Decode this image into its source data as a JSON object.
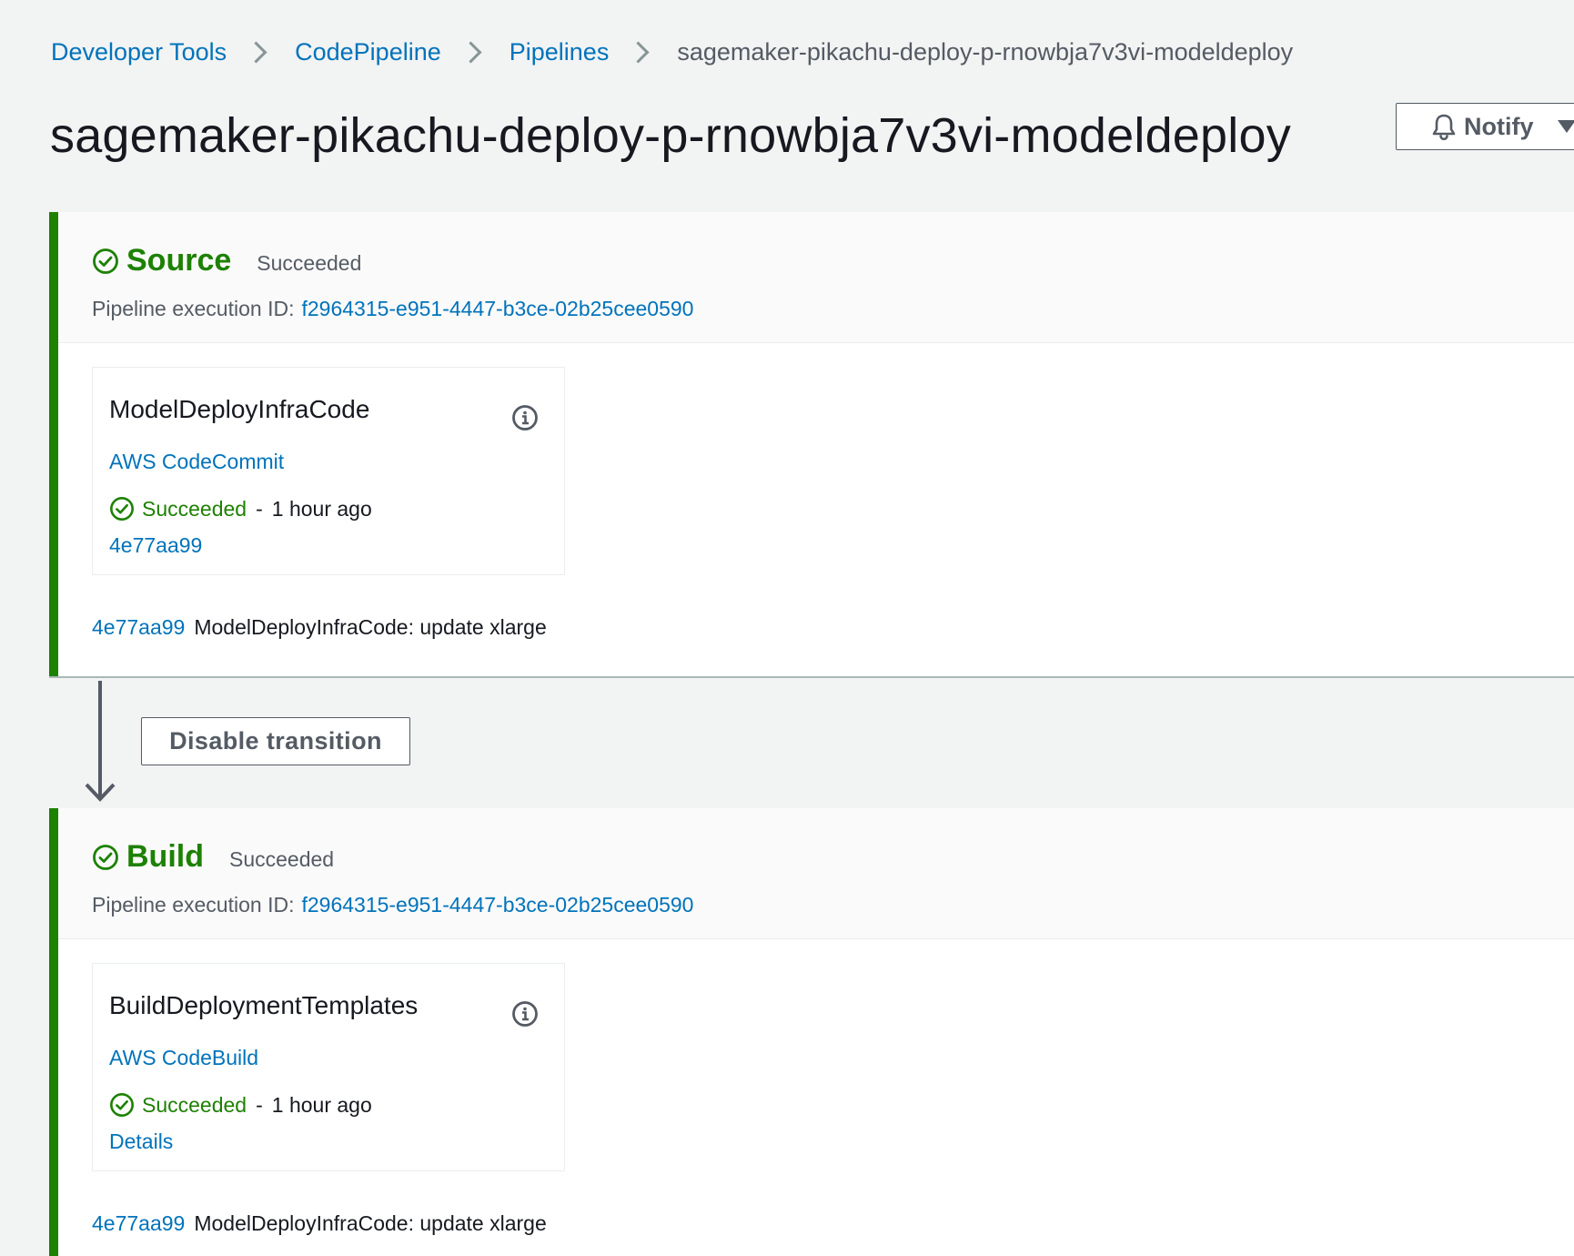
{
  "breadcrumb": {
    "items": [
      "Developer Tools",
      "CodePipeline",
      "Pipelines"
    ],
    "current": "sagemaker-pikachu-deploy-p-rnowbja7v3vi-modeldeploy"
  },
  "title": "sagemaker-pikachu-deploy-p-rnowbja7v3vi-modeldeploy",
  "notify_label": "Notify",
  "transition_button": "Disable transition",
  "stages": [
    {
      "name": "Source",
      "status": "Succeeded",
      "exec_label": "Pipeline execution ID:",
      "exec_id": "f2964315-e951-4447-b3ce-02b25cee0590",
      "action": {
        "name": "ModelDeployInfraCode",
        "provider": "AWS CodeCommit",
        "status": "Succeeded",
        "separator": "-",
        "time": "1 hour ago",
        "link": "4e77aa99"
      },
      "commit": {
        "id": "4e77aa99",
        "message": "ModelDeployInfraCode: update xlarge"
      }
    },
    {
      "name": "Build",
      "status": "Succeeded",
      "exec_label": "Pipeline execution ID:",
      "exec_id": "f2964315-e951-4447-b3ce-02b25cee0590",
      "action": {
        "name": "BuildDeploymentTemplates",
        "provider": "AWS CodeBuild",
        "status": "Succeeded",
        "separator": "-",
        "time": "1 hour ago",
        "link": "Details"
      },
      "commit": {
        "id": "4e77aa99",
        "message": "ModelDeployInfraCode: update xlarge"
      }
    }
  ],
  "colors": {
    "success": "#1d8102",
    "link": "#0073bb",
    "muted": "#545b64",
    "background": "#f2f3f3"
  }
}
